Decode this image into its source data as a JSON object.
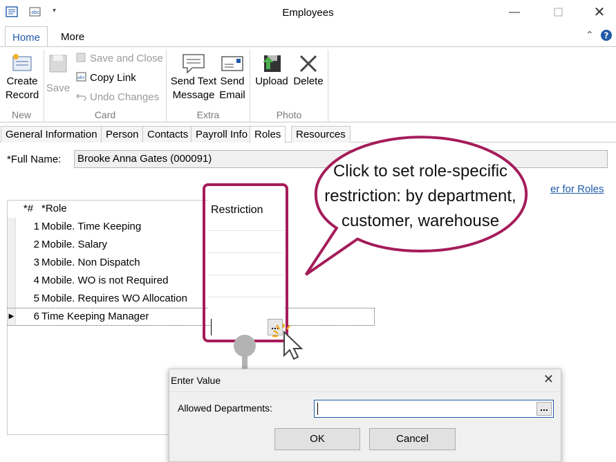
{
  "window": {
    "title": "Employees"
  },
  "ribbon": {
    "tabs": [
      "Home",
      "More"
    ],
    "groups": {
      "new": {
        "label": "New",
        "create_record": "Create Record"
      },
      "card": {
        "label": "Card",
        "save": "Save",
        "save_and_close": "Save and Close",
        "copy_link": "Copy Link",
        "undo_changes": "Undo Changes"
      },
      "extra": {
        "label": "Extra",
        "send_text_message": "Send Text Message",
        "send_email": "Send Email"
      },
      "photo": {
        "label": "Photo",
        "upload": "Upload",
        "delete": "Delete"
      }
    }
  },
  "form_tabs": [
    "General Information",
    "Person",
    "Contacts",
    "Payroll Info",
    "Roles",
    "Resources"
  ],
  "full_name": {
    "label": "*Full Name:",
    "value": "Brooke Anna Gates (000091)"
  },
  "link_partial": "er for Roles",
  "grid": {
    "headers": {
      "num": "*#",
      "role": "*Role",
      "restriction": "Restriction"
    },
    "rows": [
      {
        "num": "1",
        "role": "Mobile. Time Keeping"
      },
      {
        "num": "2",
        "role": "Mobile. Salary"
      },
      {
        "num": "3",
        "role": "Mobile. Non Dispatch"
      },
      {
        "num": "4",
        "role": "Mobile. WO is not Required"
      },
      {
        "num": "5",
        "role": "Mobile. Requires WO Allocation"
      },
      {
        "num": "6",
        "role": "Time Keeping Manager"
      }
    ],
    "ellipsis": "..."
  },
  "callout": {
    "text": "Click to set role-specific restriction: by department, customer, warehouse"
  },
  "dialog": {
    "title": "Enter Value",
    "field_label": "Allowed Departments:",
    "field_value": "",
    "ellipsis": "...",
    "ok": "OK",
    "cancel": "Cancel"
  },
  "colors": {
    "accent": "#a51c5a",
    "link": "#1e5aa8"
  }
}
